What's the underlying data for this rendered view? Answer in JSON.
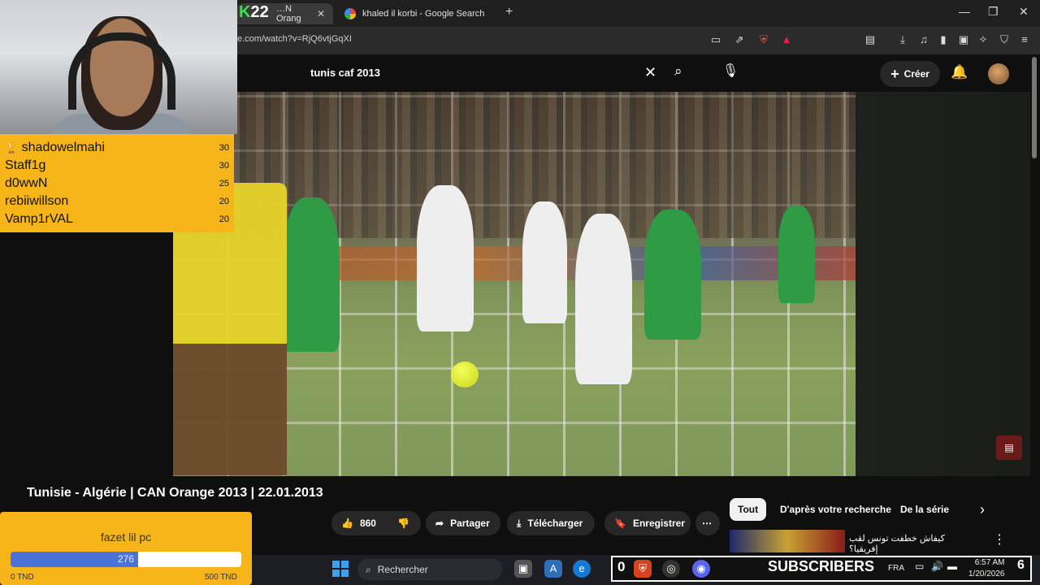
{
  "browser": {
    "tabs": [
      {
        "label": "…N Orang"
      },
      {
        "label": "khaled il korbi - Google Search"
      }
    ],
    "url": "e.com/watch?v=RjQ6vtjGqXI"
  },
  "stream_badge": {
    "letter": "K",
    "count": "22"
  },
  "youtube": {
    "search_value": "tunis caf 2013",
    "create_label": "Créer",
    "video_title": "Tunisie - Algérie | CAN Orange 2013 | 22.01.2013",
    "like_count": "860",
    "actions": {
      "share": "Partager",
      "download": "Télécharger",
      "save": "Enregistrer"
    },
    "chips": [
      "Tout",
      "D'après votre recherche",
      "De la série"
    ],
    "recommended_title": "كيفاش خطفت تونس لقب إفريقيا؟"
  },
  "leaderboard": [
    {
      "name": "shadowelmahi",
      "points": "30",
      "icon": "trophy-icon"
    },
    {
      "name": "Staff1g",
      "points": "30"
    },
    {
      "name": "d0wwN",
      "points": "25"
    },
    {
      "name": "rebiiwillson",
      "points": "20"
    },
    {
      "name": "Vamp1rVAL",
      "points": "20"
    }
  ],
  "goal": {
    "name": "fazet lil pc",
    "current": "276",
    "min_label": "0 TND",
    "max_label": "500 TND",
    "progress_fraction": 0.552
  },
  "taskbar": {
    "search_placeholder": "Rechercher",
    "subscribers_count": "0",
    "subscribers_label": "SUBSCRIBERS",
    "language": "FRA",
    "time": "6:57 AM",
    "date": "1/20/2026",
    "notification_count": "6"
  },
  "colors": {
    "overlay_yellow": "#f7b519",
    "goal_fill": "#4a73d8",
    "youtube_bg": "#0f0f0f"
  }
}
